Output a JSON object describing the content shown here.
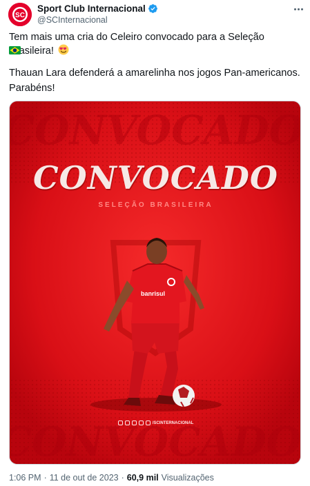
{
  "author": {
    "display_name": "Sport Club Internacional",
    "handle": "@SCInternacional",
    "verified": true,
    "avatar_icon": "sc-internacional-crest-icon",
    "avatar_color": "#e4002b"
  },
  "tweet": {
    "line1": "Tem mais uma cria do Celeiro convocado para a Seleção Brasileira!",
    "line1_emoji": "heart-eyes-emoji-icon",
    "flag_emoji": "brazil-flag-emoji-icon",
    "line2": "Thauan Lara defenderá a amarelinha nos jogos Pan-americanos.",
    "line3": "Parabéns!"
  },
  "media": {
    "headline": "CONVOCADO",
    "subheadline": "SELEÇÃO BRASILEIRA",
    "watermark_top": "CONVOCADO",
    "watermark_bottom": "CONVOCADO",
    "shirt_sponsor": "banrisul",
    "social_handle": "/SCINTERNACIONAL",
    "background_color": "#e2121f"
  },
  "footer": {
    "time": "1:06 PM",
    "separator": "·",
    "date": "11 de out de 2023",
    "views_count": "60,9 mil",
    "views_label": "Visualizações"
  },
  "colors": {
    "verified": "#1d9bf0",
    "text_secondary": "#536471"
  }
}
